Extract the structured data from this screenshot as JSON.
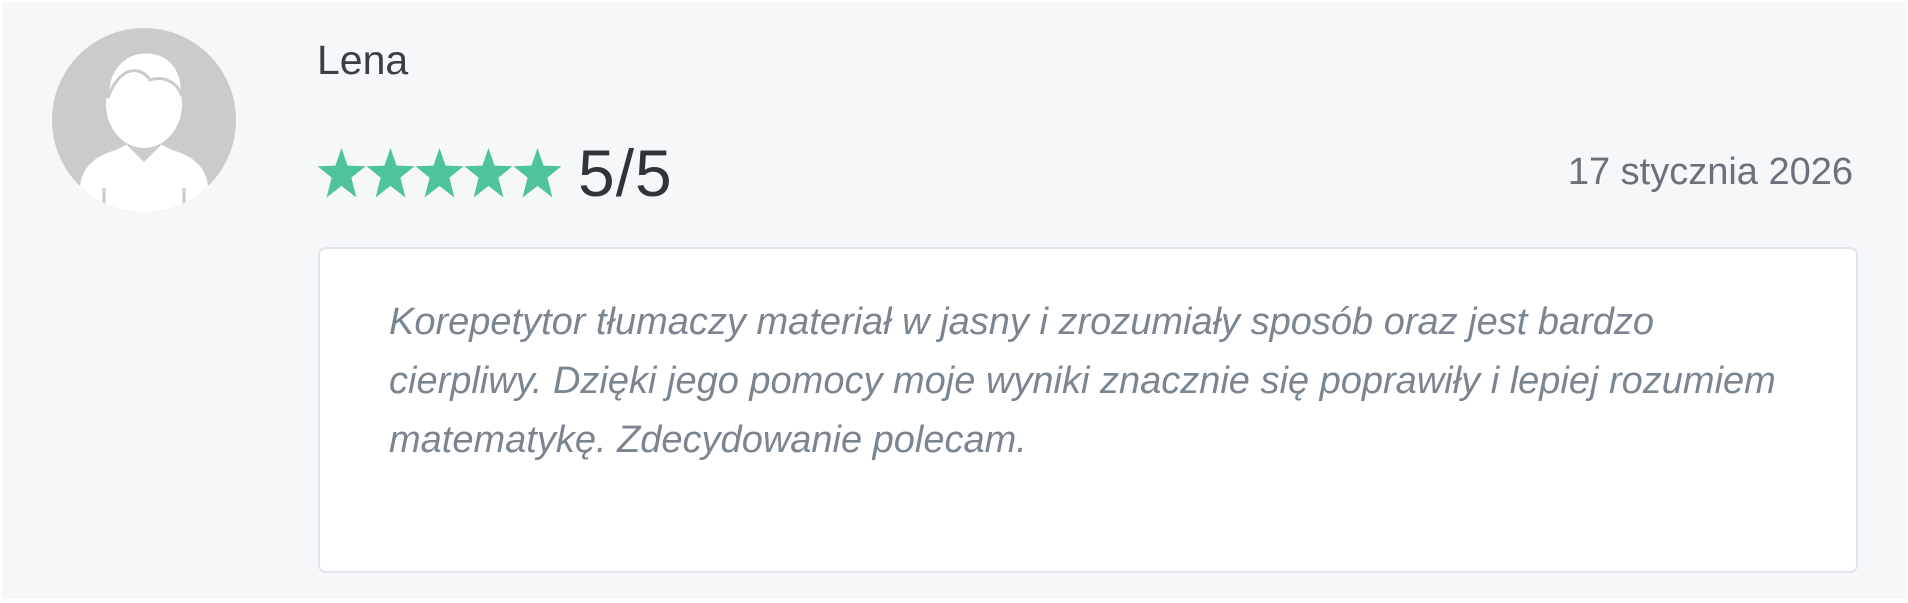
{
  "review": {
    "reviewer_name": "Lena",
    "avatar_icon": "default-user-avatar-icon",
    "rating": {
      "stars_filled": 5,
      "stars_total": 5,
      "score_text": "5/5",
      "star_icon": "star-icon",
      "star_color": "#4ec49b"
    },
    "date": "17 stycznia 2026",
    "text": "Korepetytor tłumaczy materiał w jasny i zrozumiały sposób oraz jest bardzo cierpliwy. Dzięki jego pomocy moje wyniki znacznie się poprawiły i lepiej rozumiem matematykę. Zdecydowanie polecam."
  }
}
